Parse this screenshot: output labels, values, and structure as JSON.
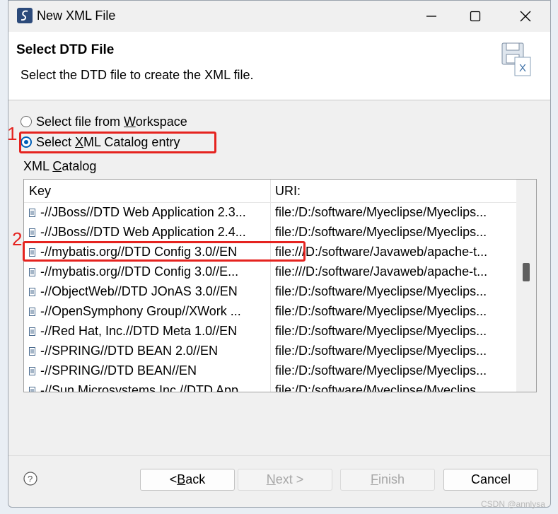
{
  "window": {
    "title": "New XML File"
  },
  "header": {
    "title": "Select DTD File",
    "description": "Select the DTD file to create the XML file."
  },
  "options": {
    "workspace": {
      "pre": "Select file from ",
      "mnemonic": "W",
      "post": "orkspace",
      "checked": false
    },
    "catalog": {
      "pre": "Select ",
      "mnemonic": "X",
      "post": "ML Catalog entry",
      "checked": true
    }
  },
  "annotations": {
    "one": "1",
    "two": "2"
  },
  "catalog": {
    "label_pre": "XML ",
    "label_mnemonic": "C",
    "label_post": "atalog",
    "columns": {
      "key": "Key",
      "uri": "URI:"
    },
    "rows": [
      {
        "key": "-//JBoss//DTD Web Application 2.3...",
        "uri": "file:/D:/software/Myeclipse/Myeclips..."
      },
      {
        "key": "-//JBoss//DTD Web Application 2.4...",
        "uri": "file:/D:/software/Myeclipse/Myeclips..."
      },
      {
        "key": "-//mybatis.org//DTD Config 3.0//EN",
        "uri": "file:///D:/software/Javaweb/apache-t..."
      },
      {
        "key": "-//mybatis.org//DTD Config 3.0//E...",
        "uri": "file:///D:/software/Javaweb/apache-t..."
      },
      {
        "key": "-//ObjectWeb//DTD JOnAS 3.0//EN",
        "uri": "file:/D:/software/Myeclipse/Myeclips..."
      },
      {
        "key": "-//OpenSymphony Group//XWork ...",
        "uri": "file:/D:/software/Myeclipse/Myeclips..."
      },
      {
        "key": "-//Red Hat, Inc.//DTD Meta 1.0//EN",
        "uri": "file:/D:/software/Myeclipse/Myeclips..."
      },
      {
        "key": "-//SPRING//DTD BEAN 2.0//EN",
        "uri": "file:/D:/software/Myeclipse/Myeclips..."
      },
      {
        "key": "-//SPRING//DTD BEAN//EN",
        "uri": "file:/D:/software/Myeclipse/Myeclips..."
      },
      {
        "key": "-//Sun Microsystems Inc //DTD App",
        "uri": "file:/D:/software/Myeclipse/Myeclips"
      }
    ]
  },
  "buttons": {
    "back": {
      "pre": "< ",
      "mnemonic": "B",
      "post": "ack"
    },
    "next": {
      "mnemonic": "N",
      "post": "ext >"
    },
    "finish": {
      "mnemonic": "F",
      "post": "inish"
    },
    "cancel": "Cancel"
  },
  "watermark": "CSDN @annlysa",
  "colors": {
    "accent": "#005fb8",
    "annotation": "#e5231f"
  }
}
